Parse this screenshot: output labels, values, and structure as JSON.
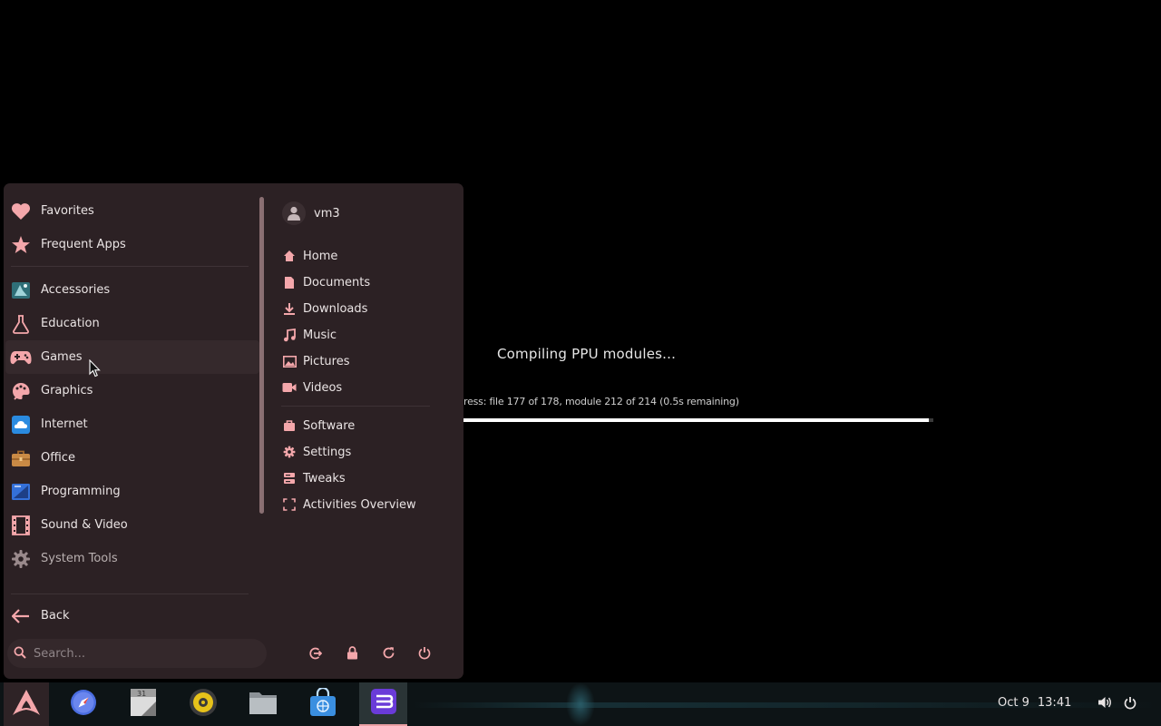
{
  "compile": {
    "title": "Compiling PPU modules...",
    "progress_text": "ress: file 177 of 178, module 212 of 214 (0.5s remaining)",
    "progress_fraction": 0.99
  },
  "menu": {
    "categories": [
      {
        "label": "Favorites",
        "icon": "heart-icon"
      },
      {
        "label": "Frequent Apps",
        "icon": "star-icon"
      },
      {
        "label": "Accessories",
        "icon": "accessories-icon"
      },
      {
        "label": "Education",
        "icon": "flask-icon"
      },
      {
        "label": "Games",
        "icon": "gamepad-icon"
      },
      {
        "label": "Graphics",
        "icon": "palette-icon"
      },
      {
        "label": "Internet",
        "icon": "cloud-icon"
      },
      {
        "label": "Office",
        "icon": "briefcase-icon"
      },
      {
        "label": "Programming",
        "icon": "programming-icon"
      },
      {
        "label": "Sound & Video",
        "icon": "film-icon"
      },
      {
        "label": "System Tools",
        "icon": "gear-icon"
      }
    ],
    "back_label": "Back",
    "user_name": "vm3",
    "places": [
      {
        "label": "Home",
        "icon": "home-icon"
      },
      {
        "label": "Documents",
        "icon": "document-icon"
      },
      {
        "label": "Downloads",
        "icon": "download-icon"
      },
      {
        "label": "Music",
        "icon": "music-icon"
      },
      {
        "label": "Pictures",
        "icon": "picture-icon"
      },
      {
        "label": "Videos",
        "icon": "video-icon"
      }
    ],
    "system": [
      {
        "label": "Software",
        "icon": "software-bag-icon"
      },
      {
        "label": "Settings",
        "icon": "gear-icon"
      },
      {
        "label": "Tweaks",
        "icon": "tweaks-icon"
      },
      {
        "label": "Activities Overview",
        "icon": "activities-icon"
      }
    ],
    "search_placeholder": "Search...",
    "session_buttons": [
      "logout-icon",
      "lock-icon",
      "restart-icon",
      "power-icon"
    ]
  },
  "taskbar": {
    "apps": [
      "arch-menu-icon",
      "browser-icon",
      "calendar-icon",
      "rhythmbox-icon",
      "files-icon",
      "software-store-icon",
      "app-icon"
    ],
    "active_app": "app-icon",
    "date": "Oct 9",
    "time": "13:41",
    "tray": [
      "volume-icon",
      "power-icon"
    ]
  },
  "colors": {
    "accent": "#f4a7ab",
    "menu_bg": "#2c2124",
    "taskbar_bg": "#0d1416"
  }
}
